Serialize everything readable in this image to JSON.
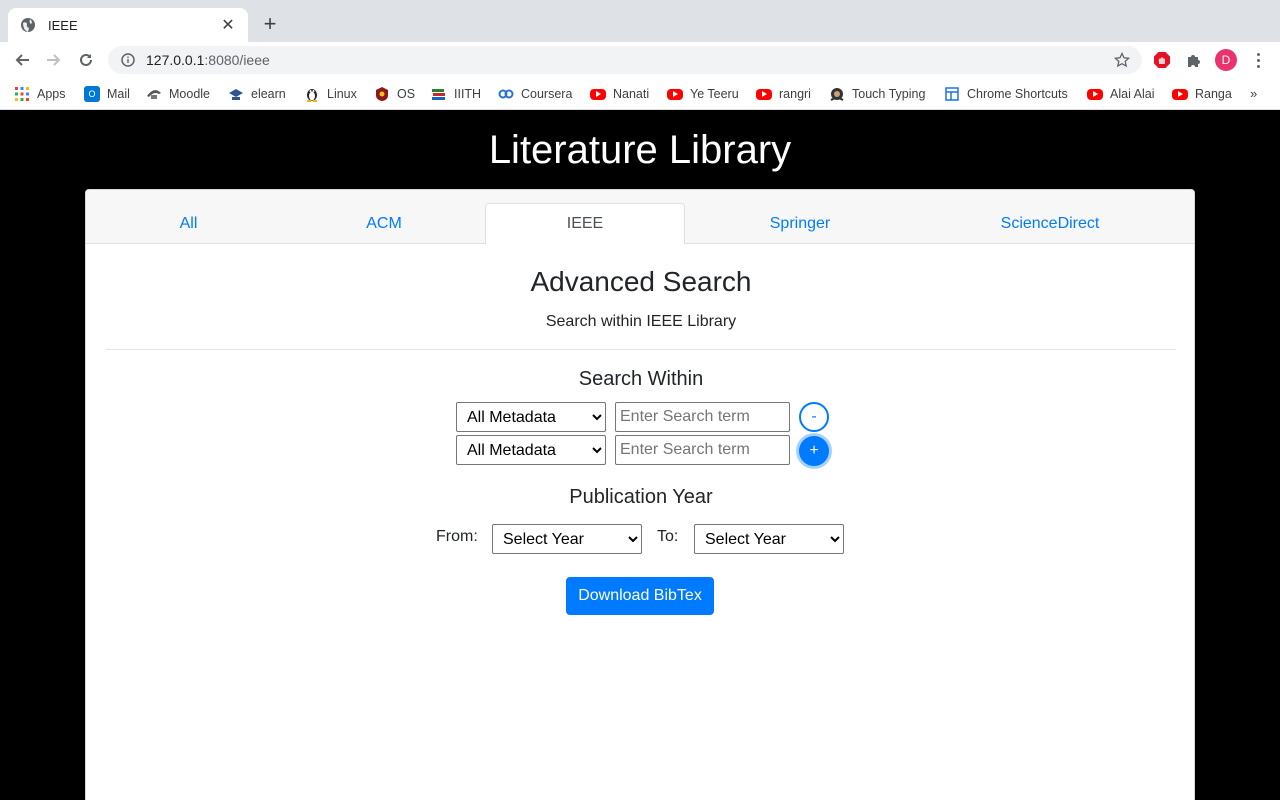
{
  "browser": {
    "tab_title": "IEEE",
    "url_host": "127.0.0.1",
    "url_rest": ":8080/ieee",
    "profile_initial": "D",
    "bookmarks": [
      {
        "label": "Apps",
        "icon": "apps-grid-icon"
      },
      {
        "label": "Mail",
        "icon": "outlook-icon"
      },
      {
        "label": "Moodle",
        "icon": "moodle-icon"
      },
      {
        "label": "elearn",
        "icon": "elearn-icon"
      },
      {
        "label": "Linux",
        "icon": "linux-icon"
      },
      {
        "label": "OS",
        "icon": "os-icon"
      },
      {
        "label": "IIITH",
        "icon": "books-icon"
      },
      {
        "label": "Coursera",
        "icon": "coursera-icon"
      },
      {
        "label": "Nanati",
        "icon": "youtube-icon"
      },
      {
        "label": "Ye Teeru",
        "icon": "youtube-icon"
      },
      {
        "label": "rangri",
        "icon": "youtube-icon"
      },
      {
        "label": "Touch Typing",
        "icon": "typing-icon"
      },
      {
        "label": "Chrome Shortcuts",
        "icon": "page-icon"
      },
      {
        "label": "Alai Alai",
        "icon": "youtube-icon"
      },
      {
        "label": "Ranga",
        "icon": "youtube-icon"
      }
    ],
    "more_bookmarks": "»"
  },
  "page": {
    "title": "Literature Library",
    "tabs": [
      "All",
      "ACM",
      "IEEE",
      "Springer",
      "ScienceDirect"
    ],
    "active_tab": "IEEE",
    "heading": "Advanced Search",
    "subtitle": "Search within IEEE Library",
    "search_within_heading": "Search Within",
    "rows": [
      {
        "field": "All Metadata",
        "placeholder": "Enter Search term",
        "action": "-"
      },
      {
        "field": "All Metadata",
        "placeholder": "Enter Search term",
        "action": "+"
      }
    ],
    "publication_year_heading": "Publication Year",
    "from_label": "From:",
    "to_label": "To:",
    "from_value": "Select Year",
    "to_value": "Select Year",
    "download_label": "Download BibTex"
  },
  "colors": {
    "accent": "#007bff",
    "page_bg": "#000000",
    "youtube": "#ff0000",
    "profile": "#e8336d"
  }
}
